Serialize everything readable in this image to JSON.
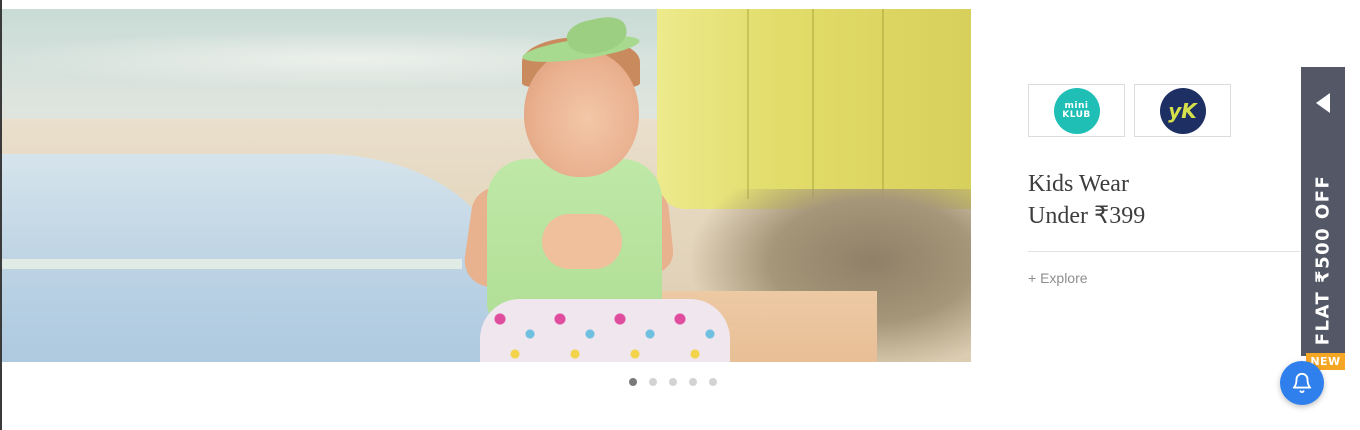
{
  "banner": {
    "image_description": "baby-on-beach-banner"
  },
  "carousel": {
    "slide_count": 5,
    "active_index": 0
  },
  "promo": {
    "brands": [
      {
        "name": "Mini Klub",
        "logo_text": "mini KLUB",
        "color": "#1fbfb5"
      },
      {
        "name": "YK",
        "logo_text": "yK",
        "color": "#1d2f63"
      }
    ],
    "headline_line1": "Kids Wear",
    "headline_line2": "Under ₹399",
    "explore_label": "+ Explore"
  },
  "offer_tab": {
    "text": "FLAT ₹500 OFF",
    "badge": "NEW",
    "color": "#535766",
    "badge_color": "#f5a623"
  },
  "notification": {
    "icon": "bell-icon",
    "color": "#2f80ed"
  }
}
